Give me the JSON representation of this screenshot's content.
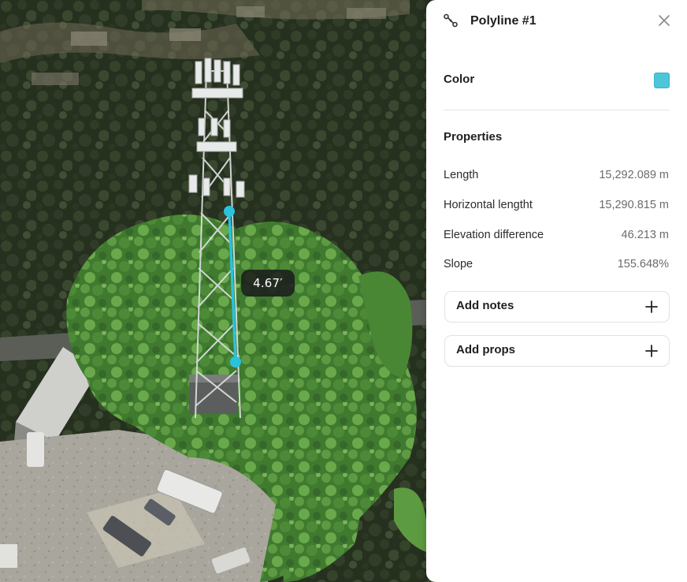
{
  "viewport": {
    "measurement_label": "4.67′",
    "line_color": "#29c3dd"
  },
  "panel": {
    "title": "Polyline #1",
    "title_icon": "polyline-icon",
    "close_icon": "close-icon",
    "color": {
      "label": "Color",
      "value": "#4cc6d8"
    },
    "properties_title": "Properties",
    "properties": [
      {
        "label": "Length",
        "value": "15,292.089 m"
      },
      {
        "label": "Horizontal lengtht",
        "value": "15,290.815 m"
      },
      {
        "label": "Elevation difference",
        "value": "46.213 m"
      },
      {
        "label": "Slope",
        "value": "155.648%"
      }
    ],
    "actions": [
      {
        "label": "Add notes",
        "icon": "plus-icon"
      },
      {
        "label": "Add props",
        "icon": "plus-icon"
      }
    ]
  }
}
